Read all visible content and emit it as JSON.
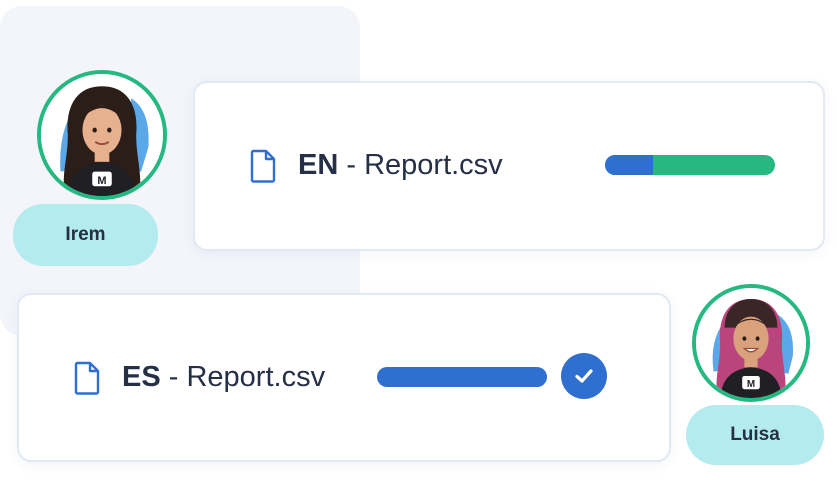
{
  "files": [
    {
      "lang": "EN",
      "separator": " - ",
      "name": "Report.csv",
      "progress": {
        "primary_fraction": 0.28,
        "primary_color": "#2f6fd0",
        "secondary_color": "#25b881"
      },
      "done": false
    },
    {
      "lang": "ES",
      "separator": " - ",
      "name": "Report.csv",
      "progress": {
        "primary_fraction": 1.0,
        "primary_color": "#2f6fd0",
        "secondary_color": "#25b881"
      },
      "done": true
    }
  ],
  "users": [
    {
      "name": "Irem",
      "hair_color": "#2b1d17",
      "avatar_bg": "#5aa8e8"
    },
    {
      "name": "Luisa",
      "hair_color": "#b9457c",
      "avatar_bg": "#5aa8e8"
    }
  ],
  "icons": {
    "file": "file-icon",
    "check": "check-circle-icon"
  },
  "colors": {
    "accent_blue": "#2f6fd0",
    "accent_green": "#25b881",
    "pill_bg": "#b4ebee",
    "text": "#253046"
  }
}
